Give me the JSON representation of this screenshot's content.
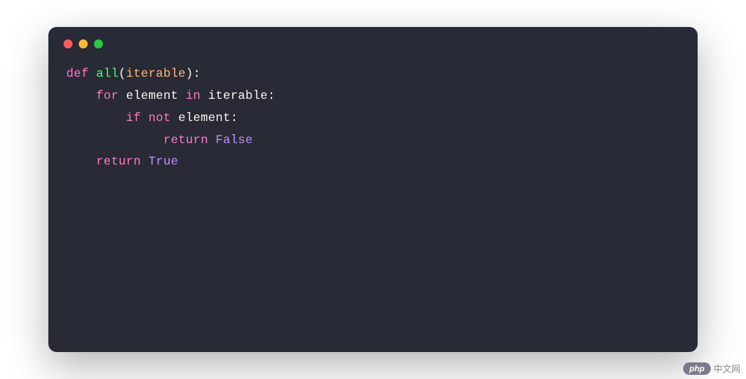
{
  "code": {
    "line1": {
      "kw_def": "def",
      "fn_name": "all",
      "paren_open": "(",
      "param": "iterable",
      "paren_close": ")",
      "colon": ":"
    },
    "line2": {
      "indent": "    ",
      "kw_for": "for",
      "var": "element",
      "kw_in": "in",
      "iter": "iterable",
      "colon": ":"
    },
    "line3": {
      "indent": "        ",
      "kw_if": "if",
      "kw_not": "not",
      "var": "element",
      "colon": ":"
    },
    "line4": {
      "indent": "             ",
      "kw_return": "return",
      "val": "False"
    },
    "line5": {
      "indent": "    ",
      "kw_return": "return",
      "val": "True"
    }
  },
  "watermark": {
    "badge": "php",
    "text": "中文网"
  }
}
